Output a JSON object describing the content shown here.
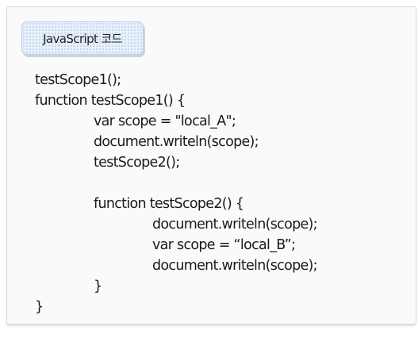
{
  "header": {
    "label": "JavaScript 코드"
  },
  "code": {
    "lines": [
      {
        "text": "testScope1();",
        "indent": 0
      },
      {
        "text": "function testScope1() {",
        "indent": 0
      },
      {
        "text": "var scope = \"local_A\";",
        "indent": 1
      },
      {
        "text": "document.writeln(scope);",
        "indent": 1
      },
      {
        "text": "testScope2();",
        "indent": 1
      },
      {
        "text": "",
        "indent": 0
      },
      {
        "text": "function testScope2() {",
        "indent": 1
      },
      {
        "text": "document.writeln(scope);",
        "indent": 2
      },
      {
        "text": "var scope = “local_B”;",
        "indent": 2
      },
      {
        "text": "document.writeln(scope);",
        "indent": 2
      },
      {
        "text": "}",
        "indent": 1
      },
      {
        "text": "}",
        "indent": 0
      }
    ]
  }
}
